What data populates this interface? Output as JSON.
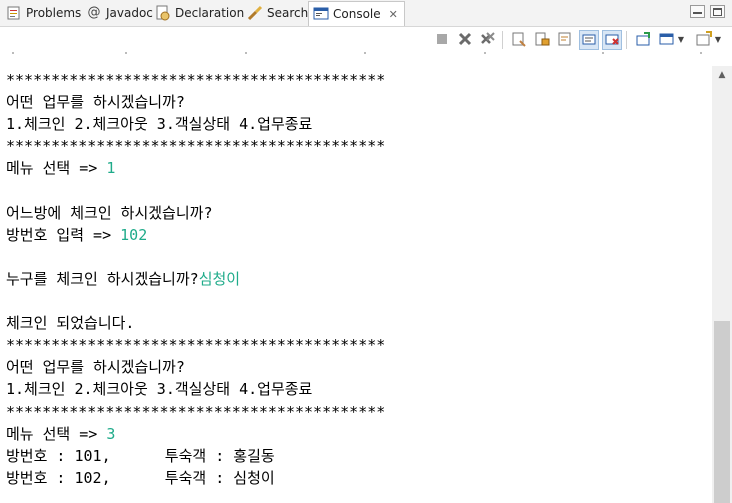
{
  "tabs": [
    {
      "label": "Problems",
      "icon": "problems-icon"
    },
    {
      "label": "Javadoc",
      "icon": "javadoc-icon"
    },
    {
      "label": "Declaration",
      "icon": "declaration-icon"
    },
    {
      "label": "Search",
      "icon": "search-icon"
    },
    {
      "label": "Console",
      "icon": "console-icon",
      "active": true
    }
  ],
  "console": {
    "lines": [
      {
        "text": "******************************************"
      },
      {
        "text": "어떤 업무를 하시겠습니까?"
      },
      {
        "text": "1.체크인 2.체크아웃 3.객실상태 4.업무종료"
      },
      {
        "text": "******************************************"
      },
      {
        "text": "메뉴 선택 => ",
        "input": "1"
      },
      {
        "text": ""
      },
      {
        "text": "어느방에 체크인 하시겠습니까?"
      },
      {
        "text": "방번호 입력 => ",
        "input": "102"
      },
      {
        "text": ""
      },
      {
        "text": "누구를 체크인 하시겠습니까?",
        "input": "심청이"
      },
      {
        "text": ""
      },
      {
        "text": "체크인 되었습니다."
      },
      {
        "text": "******************************************"
      },
      {
        "text": "어떤 업무를 하시겠습니까?"
      },
      {
        "text": "1.체크인 2.체크아웃 3.객실상태 4.업무종료"
      },
      {
        "text": "******************************************"
      },
      {
        "text": "메뉴 선택 => ",
        "input": "3"
      },
      {
        "text": "방번호 : 101,      투숙객 : 홍길동"
      },
      {
        "text": "방번호 : 102,      투숙객 : 심청이"
      }
    ]
  },
  "colors": {
    "user_input": "#1fab8a"
  }
}
